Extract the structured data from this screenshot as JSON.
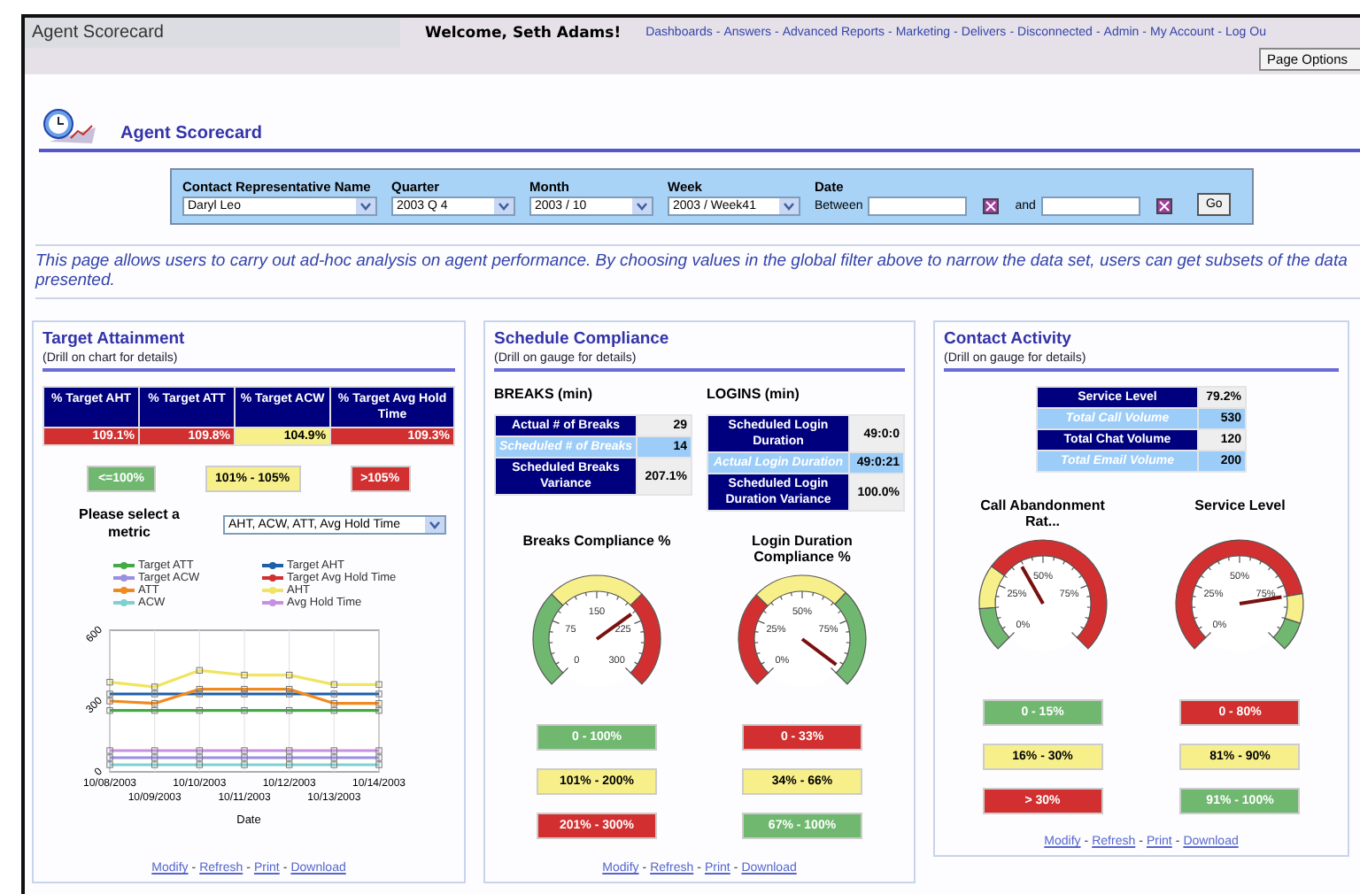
{
  "top_bar": {
    "title": "Agent Scorecard",
    "welcome": "Welcome, Seth Adams!",
    "nav_links": [
      "Dashboards",
      "Answers",
      "Advanced Reports",
      "Marketing",
      "Delivers",
      "Disconnected",
      "Admin",
      "My Account",
      "Log Ou"
    ],
    "separator": "-",
    "page_options": "Page Options"
  },
  "page_header": {
    "title": "Agent Scorecard"
  },
  "filters": [
    {
      "kind": "select",
      "label": "Contact Representative Name",
      "value": "Daryl Leo"
    },
    {
      "kind": "select",
      "label": "Quarter",
      "value": "2003 Q 4"
    },
    {
      "kind": "select",
      "label": "Month",
      "value": "2003 / 10"
    },
    {
      "kind": "select",
      "label": "Week",
      "value": "2003 / Week41"
    },
    {
      "kind": "range",
      "label": "Date",
      "prefix": "Between",
      "joiner": "and"
    }
  ],
  "go_button": "Go",
  "description": "This page allows users to carry out ad-hoc analysis on agent performance. By choosing values in the global filter above to narrow the data set, users can get subsets of the data presented.",
  "target_attainment": {
    "title": "Target Attainment",
    "subtitle": "(Drill on chart for details)",
    "columns": [
      "% Target AHT",
      "% Target ATT",
      "% Target ACW",
      "% Target Avg Hold Time"
    ],
    "values": [
      {
        "text": "109.1%",
        "color": "#d23030"
      },
      {
        "text": "109.8%",
        "color": "#d23030"
      },
      {
        "text": "104.9%",
        "color": "#f7f08a"
      },
      {
        "text": "109.3%",
        "color": "#d23030"
      }
    ],
    "legend": [
      {
        "label": "<=100%",
        "color": "#70b870"
      },
      {
        "label": "101% - 105%",
        "color": "#f7f08a"
      },
      {
        "label": ">105%",
        "color": "#d23030"
      }
    ],
    "metric": {
      "label": "Please select a metric",
      "value": "AHT, ACW, ATT, Avg Hold Time"
    },
    "chart_data": {
      "type": "line",
      "xlabel": "Date",
      "categories": [
        "10/08/2003",
        "10/09/2003",
        "10/10/2003",
        "10/11/2003",
        "10/12/2003",
        "10/13/2003",
        "10/14/2003"
      ],
      "ylim": [
        0,
        600
      ],
      "yticks": [
        0,
        300,
        600
      ],
      "grid": true,
      "series": [
        {
          "name": "Target ATT",
          "color": "#44aa44",
          "marker": true,
          "values": [
            260,
            260,
            260,
            260,
            260,
            260,
            260
          ]
        },
        {
          "name": "Target AHT",
          "color": "#1f5fa8",
          "marker": true,
          "values": [
            330,
            330,
            330,
            330,
            330,
            330,
            330
          ]
        },
        {
          "name": "Target ACW",
          "color": "#9a8fe0",
          "marker": true,
          "values": [
            60,
            60,
            60,
            60,
            60,
            60,
            60
          ]
        },
        {
          "name": "Target Avg Hold Time",
          "color": "#d03030",
          "marker": true,
          "values": [
            null,
            null,
            null,
            null,
            null,
            null,
            null
          ]
        },
        {
          "name": "ATT",
          "color": "#f08a20",
          "marker": true,
          "values": [
            300,
            290,
            350,
            350,
            350,
            290,
            290
          ]
        },
        {
          "name": "AHT",
          "color": "#f0e460",
          "marker": true,
          "values": [
            380,
            360,
            430,
            410,
            410,
            370,
            370
          ]
        },
        {
          "name": "ACW",
          "color": "#7fd0d0",
          "marker": true,
          "values": [
            30,
            30,
            30,
            30,
            30,
            30,
            30
          ]
        },
        {
          "name": "Avg Hold Time",
          "color": "#c890e0",
          "marker": true,
          "values": [
            90,
            90,
            90,
            90,
            90,
            90,
            90
          ]
        }
      ]
    },
    "footer_links": [
      "Modify",
      "Refresh",
      "Print",
      "Download"
    ]
  },
  "schedule_compliance": {
    "title": "Schedule Compliance",
    "subtitle": "(Drill on gauge for details)",
    "tables": [
      {
        "title": "BREAKS (min)",
        "rows": [
          {
            "kind": "primary",
            "label": "Actual # of Breaks",
            "value": "29"
          },
          {
            "kind": "secondary",
            "label": "Scheduled # of Breaks",
            "value": "14"
          },
          {
            "kind": "primary",
            "label": "Scheduled Breaks Variance",
            "value": "207.1%"
          }
        ]
      },
      {
        "title": "LOGINS (min)",
        "rows": [
          {
            "kind": "primary",
            "label": "Scheduled Login Duration",
            "value": "49:0:0"
          },
          {
            "kind": "secondary",
            "label": "Actual Login Duration",
            "value": "49:0:21"
          },
          {
            "kind": "primary",
            "label": "Scheduled Login Duration Variance",
            "value": "100.0%"
          }
        ]
      }
    ],
    "gauges": [
      {
        "title": "Breaks Compliance %",
        "ticks": [
          "0",
          "75",
          "150",
          "225",
          "300"
        ],
        "legend": [
          {
            "label": "0 - 100%",
            "color": "#70b870"
          },
          {
            "label": "101% - 200%",
            "color": "#f7f08a"
          },
          {
            "label": "201% - 300%",
            "color": "#d23030"
          }
        ]
      },
      {
        "title": "Login Duration Compliance %",
        "ticks": [
          "0%",
          "25%",
          "50%",
          "75%"
        ],
        "legend": [
          {
            "label": "0 - 33%",
            "color": "#d23030"
          },
          {
            "label": "34% - 66%",
            "color": "#f7f08a"
          },
          {
            "label": "67% - 100%",
            "color": "#70b870"
          }
        ]
      }
    ],
    "footer_links": [
      "Modify",
      "Refresh",
      "Print",
      "Download"
    ]
  },
  "contact_activity": {
    "title": "Contact Activity",
    "subtitle": "(Drill on gauge for details)",
    "rows": [
      {
        "kind": "primary",
        "label": "Service Level",
        "value": "79.2%"
      },
      {
        "kind": "secondary",
        "label": "Total Call Volume",
        "value": "530"
      },
      {
        "kind": "primary",
        "label": "Total Chat Volume",
        "value": "120"
      },
      {
        "kind": "secondary",
        "label": "Total Email Volume",
        "value": "200"
      }
    ],
    "gauges": [
      {
        "title": "Call Abandonment Rat...",
        "ticks": [
          "0%",
          "25%",
          "50%",
          "75%"
        ],
        "legend": [
          {
            "label": "0 - 15%",
            "color": "#70b870"
          },
          {
            "label": "16% - 30%",
            "color": "#f7f08a"
          },
          {
            "label": "> 30%",
            "color": "#d23030"
          }
        ]
      },
      {
        "title": "Service Level",
        "ticks": [
          "0%",
          "25%",
          "50%",
          "75%"
        ],
        "legend": [
          {
            "label": "0 - 80%",
            "color": "#d23030"
          },
          {
            "label": "81% - 90%",
            "color": "#f7f08a"
          },
          {
            "label": "91% - 100%",
            "color": "#70b870"
          }
        ]
      }
    ],
    "footer_links": [
      "Modify",
      "Refresh",
      "Print",
      "Download"
    ]
  }
}
